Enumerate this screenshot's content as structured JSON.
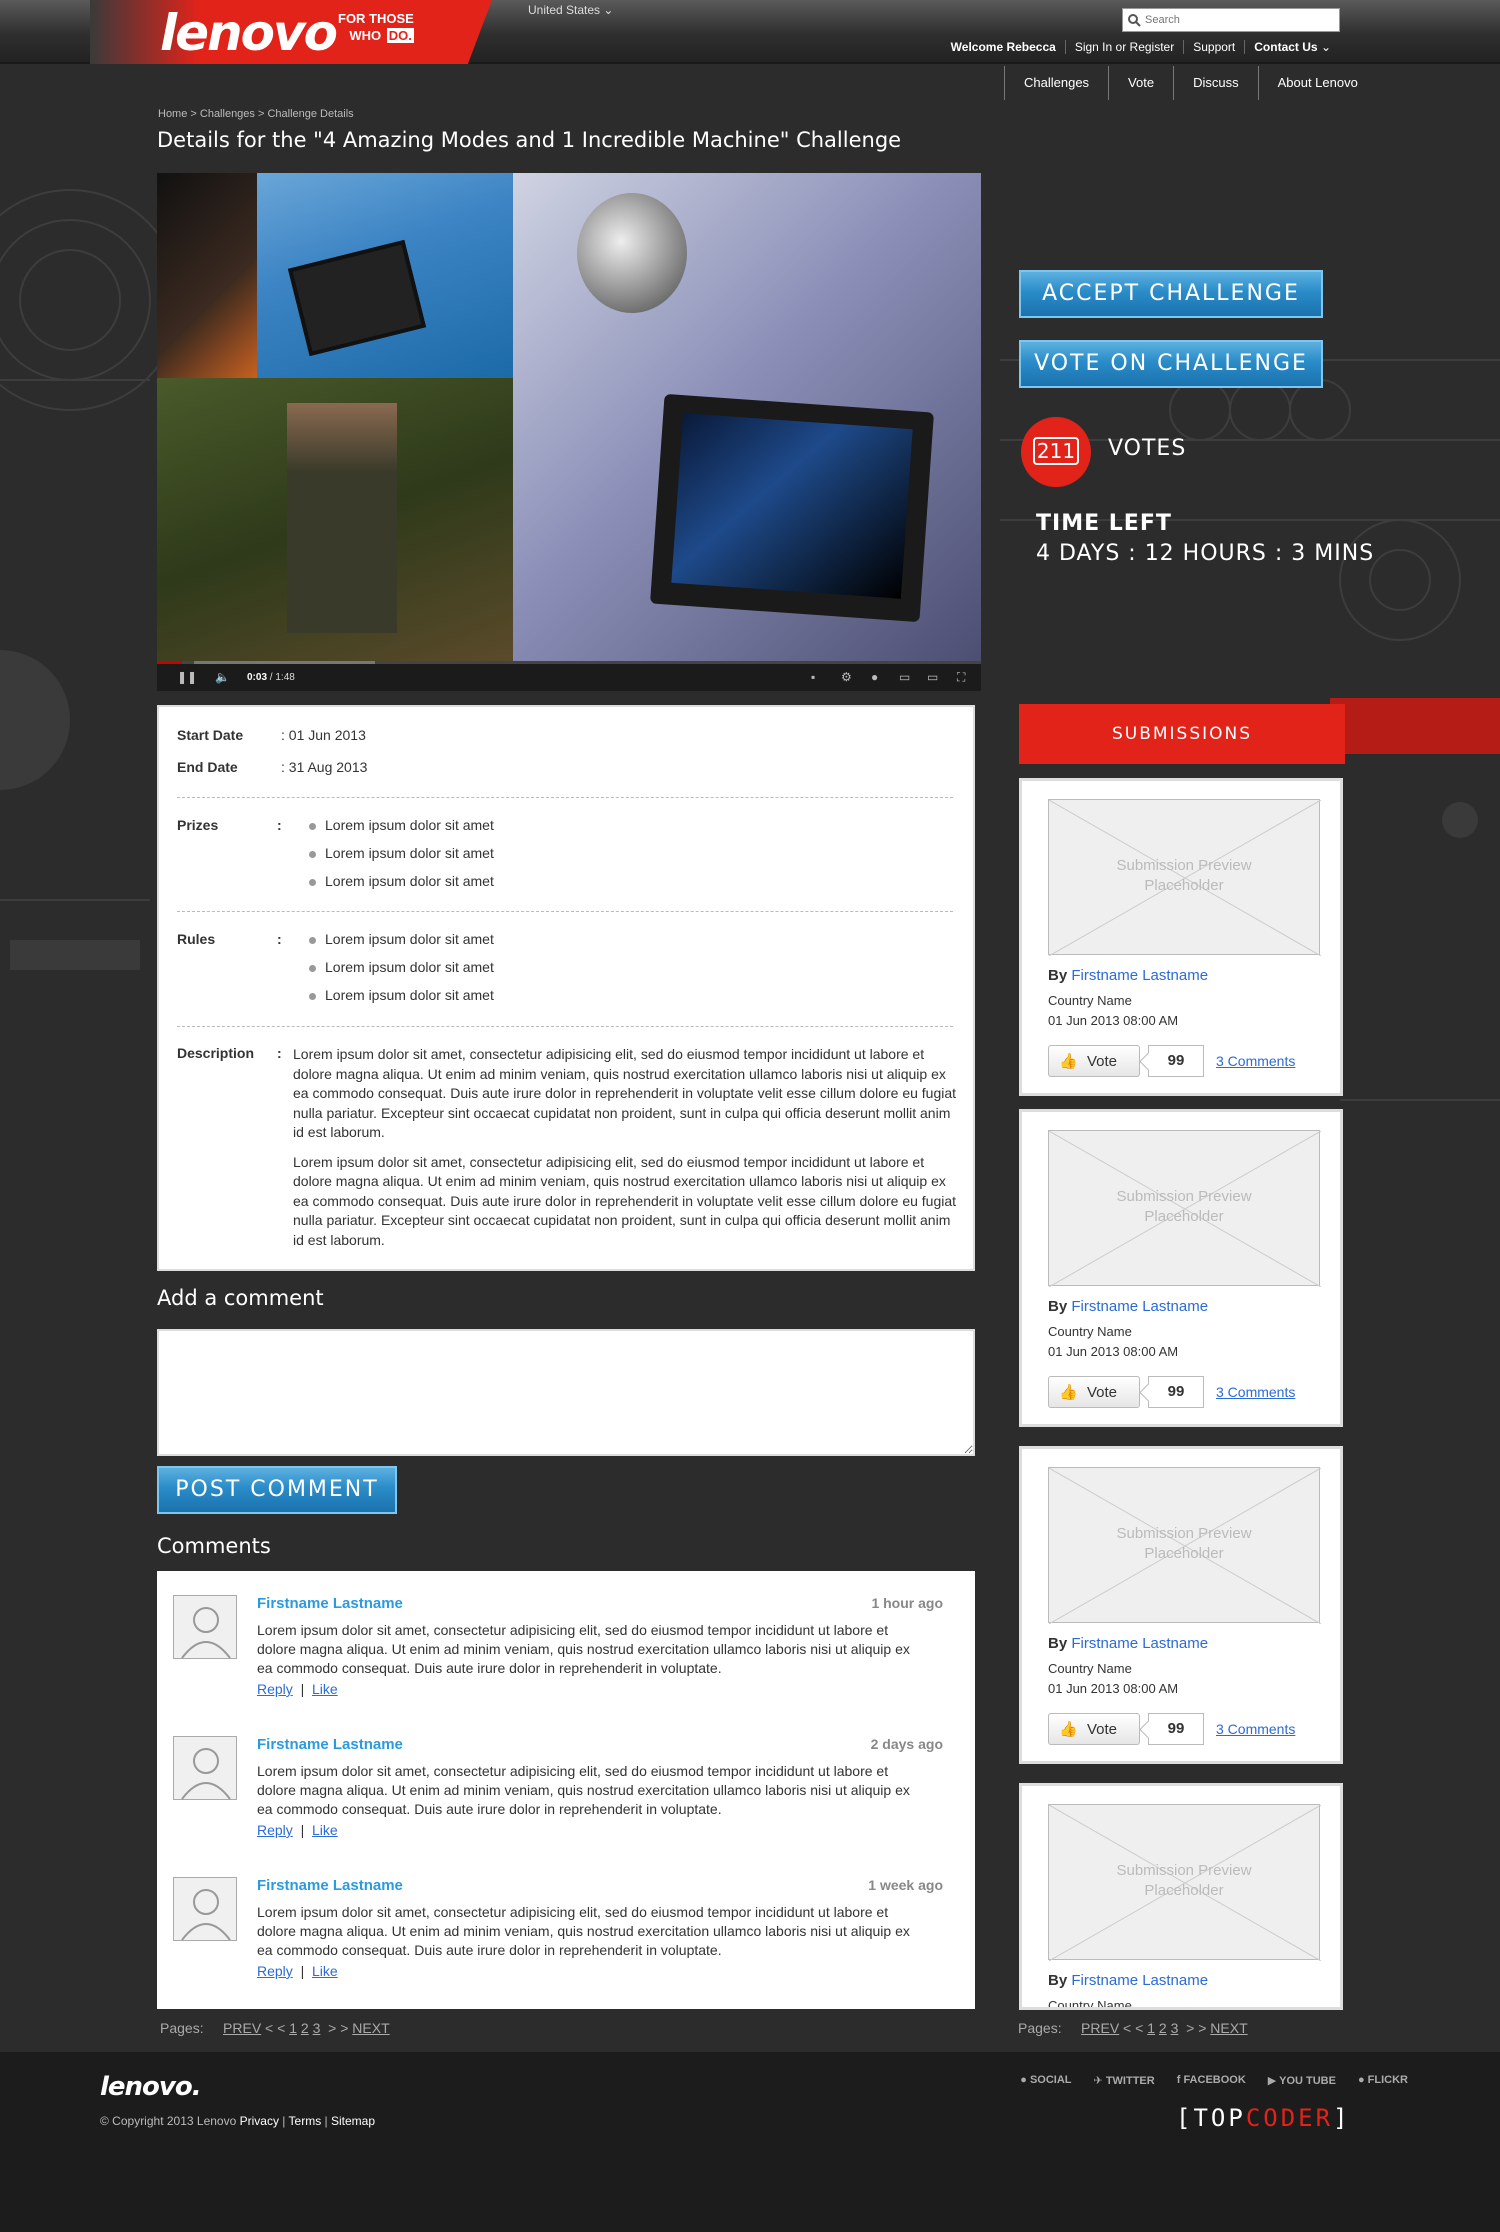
{
  "header": {
    "logo_text": "lenovo",
    "tagline_line1": "FOR THOSE",
    "tagline_line2": "WHO",
    "tagline_do": "DO.",
    "country": "United States",
    "search_placeholder": "Search",
    "welcome": "Welcome Rebecca",
    "links": [
      "Sign In or Register",
      "Support",
      "Contact Us"
    ]
  },
  "nav": [
    "Challenges",
    "Vote",
    "Discuss",
    "About Lenovo"
  ],
  "breadcrumb": "Home > Challenges > Challenge Details",
  "page_title": "Details for the \"4 Amazing Modes and 1 Incredible Machine\" Challenge",
  "video": {
    "current_time": "0:03",
    "duration": "1:48",
    "progress": 0.03
  },
  "details": {
    "start_label": "Start Date",
    "start_value": "01 Jun 2013",
    "end_label": "End Date",
    "end_value": "31 Aug 2013",
    "prizes_label": "Prizes",
    "prizes": [
      "Lorem ipsum dolor sit amet",
      "Lorem ipsum dolor sit amet",
      "Lorem ipsum dolor sit amet"
    ],
    "rules_label": "Rules",
    "rules": [
      "Lorem ipsum dolor sit amet",
      "Lorem ipsum dolor sit amet",
      "Lorem ipsum dolor sit amet"
    ],
    "description_label": "Description",
    "description": [
      "Lorem ipsum dolor sit amet, consectetur adipisicing elit, sed do eiusmod tempor incididunt ut labore et dolore magna aliqua. Ut enim ad minim veniam, quis nostrud exercitation ullamco laboris nisi ut aliquip ex ea commodo consequat. Duis aute irure dolor in reprehenderit in voluptate velit esse cillum dolore eu fugiat nulla pariatur. Excepteur sint occaecat cupidatat non proident, sunt in culpa qui officia deserunt mollit anim id est laborum.",
      "Lorem ipsum dolor sit amet, consectetur adipisicing elit, sed do eiusmod tempor incididunt ut labore et dolore magna aliqua. Ut enim ad minim veniam, quis nostrud exercitation ullamco laboris nisi ut aliquip ex ea commodo consequat. Duis aute irure dolor in reprehenderit in voluptate velit esse cillum dolore eu fugiat nulla pariatur. Excepteur sint occaecat cupidatat non proident, sunt in culpa qui officia deserunt mollit anim id est laborum."
    ]
  },
  "add_comment_title": "Add a comment",
  "post_comment_label": "POST COMMENT",
  "comments_title": "Comments",
  "comments": [
    {
      "name": "Firstname Lastname",
      "time": "1 hour ago",
      "text": "Lorem ipsum dolor sit amet, consectetur adipisicing elit, sed do eiusmod tempor incididunt ut labore et dolore magna aliqua. Ut enim ad minim veniam, quis nostrud exercitation ullamco laboris nisi ut aliquip ex ea commodo consequat. Duis aute irure dolor in reprehenderit in voluptate.",
      "reply": "Reply",
      "like": "Like"
    },
    {
      "name": "Firstname Lastname",
      "time": "2 days ago",
      "text": "Lorem ipsum dolor sit amet, consectetur adipisicing elit, sed do eiusmod tempor incididunt ut labore et dolore magna aliqua. Ut enim ad minim veniam, quis nostrud exercitation ullamco laboris nisi ut aliquip ex ea commodo consequat. Duis aute irure dolor in reprehenderit in voluptate.",
      "reply": "Reply",
      "like": "Like"
    },
    {
      "name": "Firstname Lastname",
      "time": "1 week ago",
      "text": "Lorem ipsum dolor sit amet, consectetur adipisicing elit, sed do eiusmod tempor incididunt ut labore et dolore magna aliqua. Ut enim ad minim veniam, quis nostrud exercitation ullamco laboris nisi ut aliquip ex ea commodo consequat. Duis aute irure dolor in reprehenderit in voluptate.",
      "reply": "Reply",
      "like": "Like"
    }
  ],
  "pager": {
    "label": "Pages:",
    "prev": "PREV",
    "next": "NEXT",
    "pages": [
      "1",
      "2",
      "3"
    ]
  },
  "actions": {
    "accept": "ACCEPT CHALLENGE",
    "vote": "VOTE ON CHALLENGE"
  },
  "votes": {
    "count": "211",
    "label": "VOTES"
  },
  "time_left": {
    "label": "TIME LEFT",
    "value": "4 DAYS : 12 HOURS : 3 MINS"
  },
  "submissions_title": "SUBMISSIONS",
  "submissions": [
    {
      "placeholder": "Submission Preview Placeholder",
      "by": "By",
      "author": "Firstname Lastname",
      "country": "Country Name",
      "date": "01 Jun 2013  08:00 AM",
      "vote_label": "Vote",
      "vote_count": "99",
      "comments": "3 Comments"
    },
    {
      "placeholder": "Submission Preview Placeholder",
      "by": "By",
      "author": "Firstname Lastname",
      "country": "Country Name",
      "date": "01 Jun 2013  08:00 AM",
      "vote_label": "Vote",
      "vote_count": "99",
      "comments": "3 Comments"
    },
    {
      "placeholder": "Submission Preview Placeholder",
      "by": "By",
      "author": "Firstname Lastname",
      "country": "Country Name",
      "date": "01 Jun 2013  08:00 AM",
      "vote_label": "Vote",
      "vote_count": "99",
      "comments": "3 Comments"
    },
    {
      "placeholder": "Submission Preview Placeholder",
      "by": "By",
      "author": "Firstname Lastname",
      "country": "Country Name",
      "date": "",
      "vote_label": "",
      "vote_count": "",
      "comments": ""
    }
  ],
  "footer": {
    "logo": "lenovo.",
    "copyright": "© Copyright 2013 Lenovo",
    "links": [
      "Privacy",
      "Terms",
      "Sitemap"
    ],
    "social": [
      "SOCIAL",
      "TWITTER",
      "FACEBOOK",
      "YOU TUBE",
      "FLICKR"
    ],
    "topcoder_a": "TOP",
    "topcoder_b": "CODER"
  }
}
